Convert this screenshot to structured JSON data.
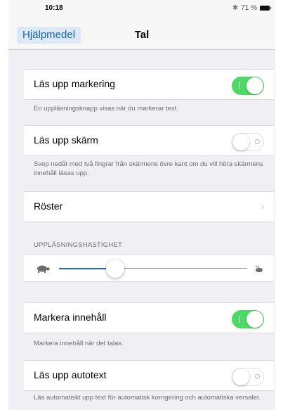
{
  "status_bar": {
    "time": "10:18",
    "bluetooth_icon": "bluetooth-icon",
    "battery_percent": "71 %"
  },
  "nav": {
    "back_label": "Hjälpmedel",
    "title": "Tal"
  },
  "speak_selection": {
    "label": "Läs upp markering",
    "on": true,
    "footer": "En uppläsningsknapp visas när du markerar text."
  },
  "speak_screen": {
    "label": "Läs upp skärm",
    "on": false,
    "footer": "Svep nedåt med två fingrar från skärmens övre kant om du vill höra skärmens innehåll läsas upp."
  },
  "voices": {
    "label": "Röster"
  },
  "speaking_rate": {
    "header": "UPPLÄSNINGSHASTIGHET",
    "value": 0.3
  },
  "highlight_content": {
    "label": "Markera innehåll",
    "on": true,
    "footer": "Markera innehåll när det talas."
  },
  "speak_autotext": {
    "label": "Läs upp autotext",
    "on": false,
    "footer": "Läs automatiskt upp text för automatisk korrigering och automatiska versaler."
  },
  "colors": {
    "toggle_on": "#4cd964",
    "accent": "#1a6bd6",
    "back_button_bg": "#dce9f5"
  }
}
